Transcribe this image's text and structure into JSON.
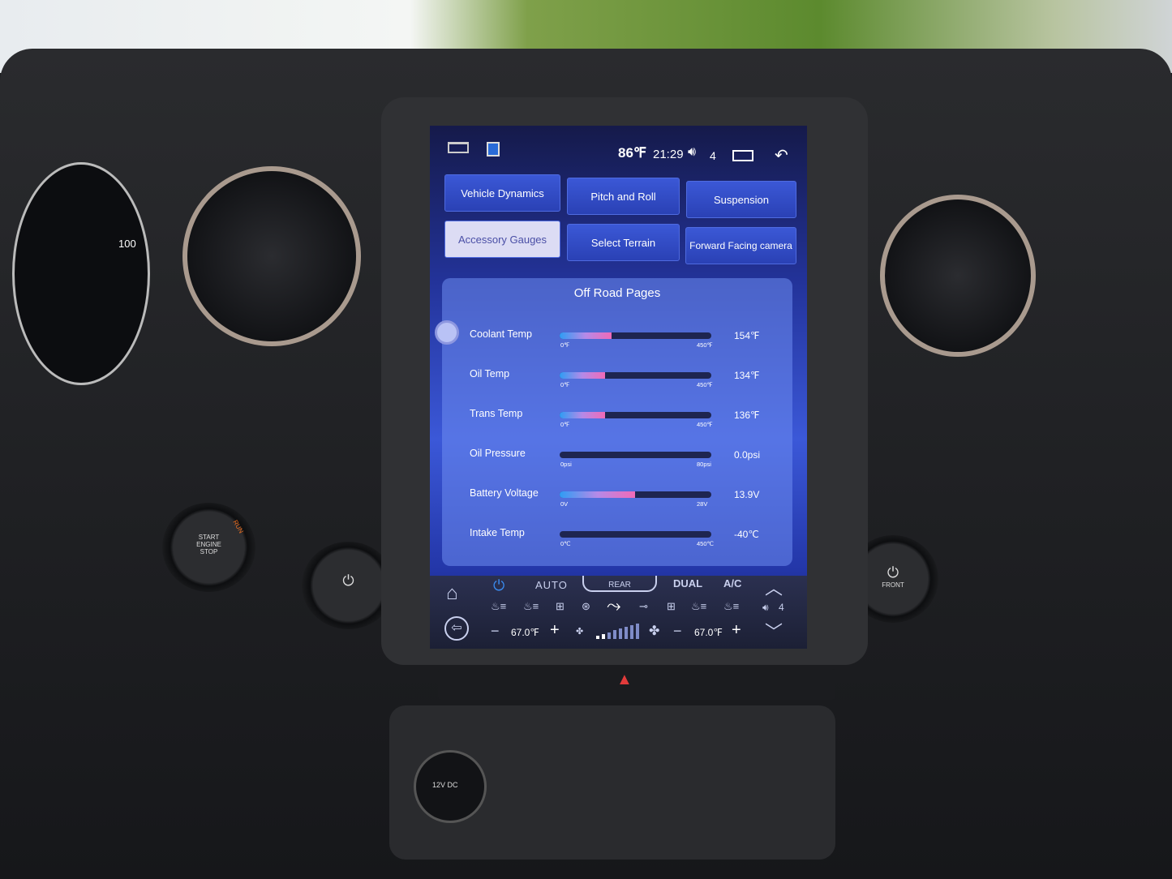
{
  "status_bar": {
    "temperature": "86℉",
    "time": "21:29",
    "volume": "4",
    "icons": [
      "home-outline-icon",
      "app-badge-icon",
      "volume-icon",
      "recent-apps-icon",
      "back-icon"
    ]
  },
  "nav_buttons": [
    {
      "label": "Vehicle Dynamics",
      "selected": false
    },
    {
      "label": "Pitch and Roll",
      "selected": false
    },
    {
      "label": "Suspension",
      "selected": false
    },
    {
      "label": "Accessory Gauges",
      "selected": true
    },
    {
      "label": "Select Terrain",
      "selected": false
    },
    {
      "label": "Forward Facing camera",
      "selected": false
    }
  ],
  "panel": {
    "title": "Off Road Pages",
    "gauges": [
      {
        "label": "Coolant Temp",
        "min": "0℉",
        "max": "450℉",
        "value": "154℉",
        "fraction": 0.342
      },
      {
        "label": "Oil Temp",
        "min": "0℉",
        "max": "450℉",
        "value": "134℉",
        "fraction": 0.298
      },
      {
        "label": "Trans Temp",
        "min": "0℉",
        "max": "450℉",
        "value": "136℉",
        "fraction": 0.302
      },
      {
        "label": "Oil Pressure",
        "min": "0psi",
        "max": "80psi",
        "value": "0.0psi",
        "fraction": 0
      },
      {
        "label": "Battery Voltage",
        "min": "0V",
        "max": "28V",
        "value": "13.9V",
        "fraction": 0.496
      },
      {
        "label": "Intake Temp",
        "min": "0℃",
        "max": "450℃",
        "value": "-40℃",
        "fraction": 0
      }
    ]
  },
  "climate": {
    "auto": "AUTO",
    "rear": "REAR",
    "dual": "DUAL",
    "ac": "A/C",
    "left_temp": "67.0℉",
    "right_temp": "67.0℉",
    "volume": "4",
    "fan_level_fraction": 0.3
  },
  "vehicle": {
    "engine_button": [
      "START",
      "ENGINE",
      "STOP"
    ],
    "run": "RUN",
    "power_dc": "12V DC",
    "front": "FRONT",
    "cluster_text": "100"
  },
  "colors": {
    "accent": "#3b58d6",
    "selected_button": "#dcdcf4",
    "fill_start": "#2f9cf4",
    "fill_end": "#f06ab8"
  }
}
